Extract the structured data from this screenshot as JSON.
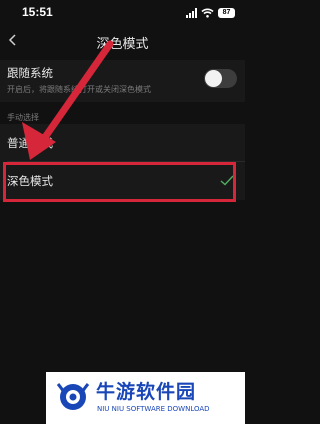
{
  "status_bar": {
    "time": "15:51",
    "battery": "87"
  },
  "nav": {
    "title": "深色模式"
  },
  "follow_system": {
    "title": "跟随系统",
    "description": "开启后，将跟随系统打开或关闭深色模式",
    "enabled": false
  },
  "manual": {
    "section_label": "手动选择",
    "options": [
      {
        "label": "普通模式",
        "selected": false
      },
      {
        "label": "深色模式",
        "selected": true
      }
    ]
  },
  "colors": {
    "annotation": "#d6273a",
    "check": "#4fae5d",
    "watermark_brand": "#1a47b8"
  },
  "watermark": {
    "title": "牛游软件园",
    "subtitle": "NIU NIU SOFTWARE DOWNLOAD"
  }
}
